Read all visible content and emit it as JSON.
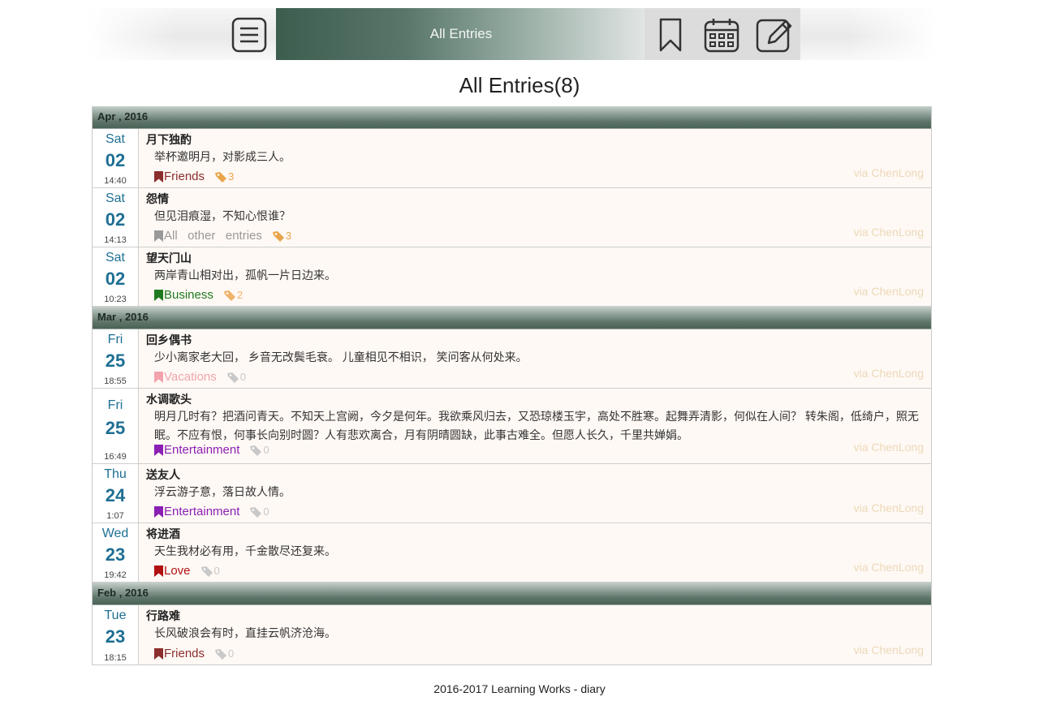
{
  "toolbar": {
    "title": "All Entries",
    "menu_icon": "menu-icon",
    "bookmark_icon": "bookmark-icon",
    "calendar_icon": "calendar-icon",
    "edit_icon": "edit-icon"
  },
  "heading": "All Entries(8)",
  "months": [
    {
      "label": "Apr , 2016",
      "entries": [
        {
          "weekday": "Sat",
          "day": "02",
          "time": "14:40",
          "title": "月下独酌",
          "text": "举杯邀明月，对影成三人。",
          "category": "Friends",
          "category_color": "#8b2e2e",
          "tag_count": "3",
          "tag_color": "#e8a64c",
          "via": "via ChenLong"
        },
        {
          "weekday": "Sat",
          "day": "02",
          "time": "14:13",
          "title": "怨情",
          "text": "但见泪痕湿，不知心恨谁？",
          "category": "All   other   entries",
          "category_color": "#999999",
          "tag_count": "3",
          "tag_color": "#e8a64c",
          "via": "via ChenLong"
        },
        {
          "weekday": "Sat",
          "day": "02",
          "time": "10:23",
          "title": "望天门山",
          "text": "两岸青山相对出，孤帆一片日边来。",
          "category": "Business",
          "category_color": "#1f7a1f",
          "tag_count": "2",
          "tag_color": "#f0b36a",
          "via": "via ChenLong"
        }
      ]
    },
    {
      "label": "Mar , 2016",
      "entries": [
        {
          "weekday": "Fri",
          "day": "25",
          "time": "18:55",
          "title": "回乡偶书",
          "text": "少小离家老大回， 乡音无改鬓毛衰。 儿童相见不相识， 笑问客从何处来。",
          "category": "Vacations",
          "category_color": "#f2a3ad",
          "tag_count": "0",
          "tag_color": "#c8c8c8",
          "via": "via ChenLong"
        },
        {
          "weekday": "Fri",
          "day": "25",
          "time": "16:49",
          "title": "水调歌头",
          "text": "明月几时有？把酒问青天。不知天上宫阙，今夕是何年。我欲乘风归去，又恐琼楼玉宇，高处不胜寒。起舞弄清影，何似在人间？ 转朱阁，低绮户，照无眠。不应有恨，何事长向别时圆？人有悲欢离合，月有阴晴圆缺，此事古难全。但愿人长久，千里共婵娟。",
          "category": "Entertainment",
          "category_color": "#8a1fb3",
          "tag_count": "0",
          "tag_color": "#c8c8c8",
          "via": "via ChenLong",
          "tall": true
        },
        {
          "weekday": "Thu",
          "day": "24",
          "time": "1:07",
          "title": "送友人",
          "text": "浮云游子意，落日故人情。",
          "category": "Entertainment",
          "category_color": "#8a1fb3",
          "tag_count": "0",
          "tag_color": "#c8c8c8",
          "via": "via ChenLong"
        },
        {
          "weekday": "Wed",
          "day": "23",
          "time": "19:42",
          "title": "将进酒",
          "text": "天生我材必有用，千金散尽还复来。",
          "category": "Love",
          "category_color": "#b01010",
          "tag_count": "0",
          "tag_color": "#c8c8c8",
          "via": "via ChenLong"
        }
      ]
    },
    {
      "label": "Feb , 2016",
      "entries": [
        {
          "weekday": "Tue",
          "day": "23",
          "time": "18:15",
          "title": "行路难",
          "text": "长风破浪会有时，直挂云帆济沧海。",
          "category": "Friends",
          "category_color": "#8b2e2e",
          "tag_count": "0",
          "tag_color": "#c8c8c8",
          "via": "via ChenLong"
        }
      ]
    }
  ],
  "footer": "2016-2017 Learning Works - diary"
}
